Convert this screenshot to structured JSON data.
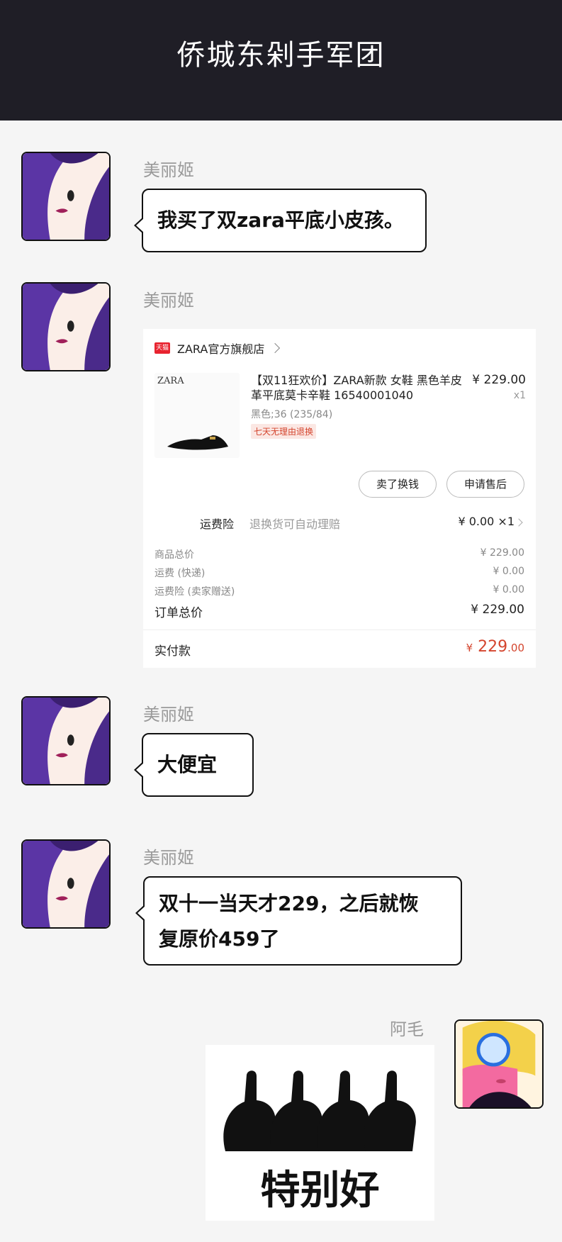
{
  "header": {
    "title": "侨城东剁手军团"
  },
  "messages": [
    {
      "sender": "美丽姬",
      "text": "我买了双zara平底小皮孩。"
    },
    {
      "sender": "美丽姬"
    },
    {
      "sender": "美丽姬",
      "text": "大便宜"
    },
    {
      "sender": "美丽姬",
      "text_line1": "双十一当天才229，之后就恢",
      "text_line2": "复原价459了"
    },
    {
      "sender": "阿毛"
    }
  ],
  "order": {
    "store_badge": "天猫",
    "store_name": "ZARA官方旗舰店",
    "product_brand": "ZARA",
    "product_title": "【双11狂欢价】ZARA新款 女鞋 黑色羊皮革平底莫卡辛鞋 16540001040",
    "price": "¥ 229.00",
    "qty": "x1",
    "variant": "黑色;36 (235/84)",
    "tag": "七天无理由退换",
    "btn_sell": "卖了换钱",
    "btn_aftersale": "申请售后",
    "insurance_label": "运费险",
    "insurance_desc": "退换货可自动理赔",
    "insurance_value": "¥ 0.00 ×1",
    "summary": [
      {
        "label": "商品总价",
        "value": "¥ 229.00"
      },
      {
        "label": "运费 (快递)",
        "value": "¥ 0.00"
      },
      {
        "label": "运费险 (卖家赠送)",
        "value": "¥ 0.00"
      }
    ],
    "total_label": "订单总价",
    "total_value": "¥ 229.00",
    "paid_label": "实付款",
    "paid_currency": "¥",
    "paid_int": "229",
    "paid_dec": ".00"
  },
  "sticker": {
    "caption": "特别好"
  },
  "colors": {
    "header_bg": "#1f1e26",
    "price_red": "#d4452e",
    "tmall_red": "#e8232f"
  }
}
